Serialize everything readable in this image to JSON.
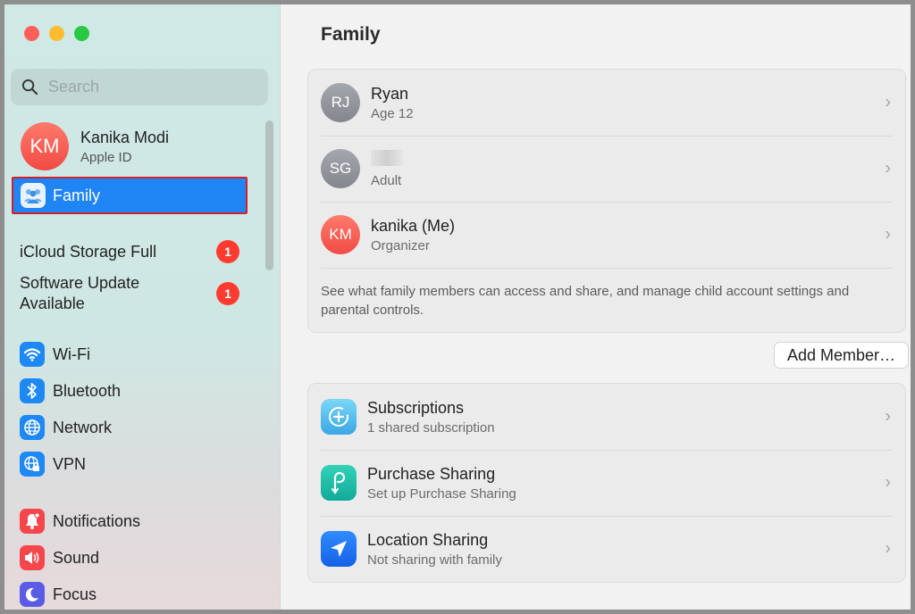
{
  "window": {
    "title": "Family"
  },
  "sidebar": {
    "search_placeholder": "Search",
    "account": {
      "initials": "KM",
      "name": "Kanika Modi",
      "subtitle": "Apple ID"
    },
    "selected_item": "Family",
    "alerts": [
      {
        "label": "iCloud Storage Full",
        "badge": "1"
      },
      {
        "label": "Software Update Available",
        "badge": "1"
      }
    ],
    "items": [
      {
        "label": "Wi-Fi",
        "icon": "wifi-icon"
      },
      {
        "label": "Bluetooth",
        "icon": "bluetooth-icon"
      },
      {
        "label": "Network",
        "icon": "globe-icon"
      },
      {
        "label": "VPN",
        "icon": "vpn-icon"
      },
      {
        "label": "Notifications",
        "icon": "bell-icon"
      },
      {
        "label": "Sound",
        "icon": "speaker-icon"
      },
      {
        "label": "Focus",
        "icon": "moon-icon"
      }
    ]
  },
  "members": [
    {
      "initials": "RJ",
      "name": "Ryan",
      "role": "Age 12"
    },
    {
      "initials": "SG",
      "name": "",
      "role": "Adult"
    },
    {
      "initials": "KM",
      "name": "kanika (Me)",
      "role": "Organizer"
    }
  ],
  "members_description": "See what family members can access and share, and manage child account settings and parental controls.",
  "add_member_label": "Add Member…",
  "features": [
    {
      "title": "Subscriptions",
      "subtitle": "1 shared subscription",
      "icon": "subscriptions-icon"
    },
    {
      "title": "Purchase Sharing",
      "subtitle": "Set up Purchase Sharing",
      "icon": "purchase-sharing-icon"
    },
    {
      "title": "Location Sharing",
      "subtitle": "Not sharing with family",
      "icon": "location-arrow-icon"
    }
  ],
  "chevron": "›",
  "colors": {
    "accent": "#1f84f4",
    "selection_outline": "#d3202a",
    "badge": "#ff3b30"
  }
}
